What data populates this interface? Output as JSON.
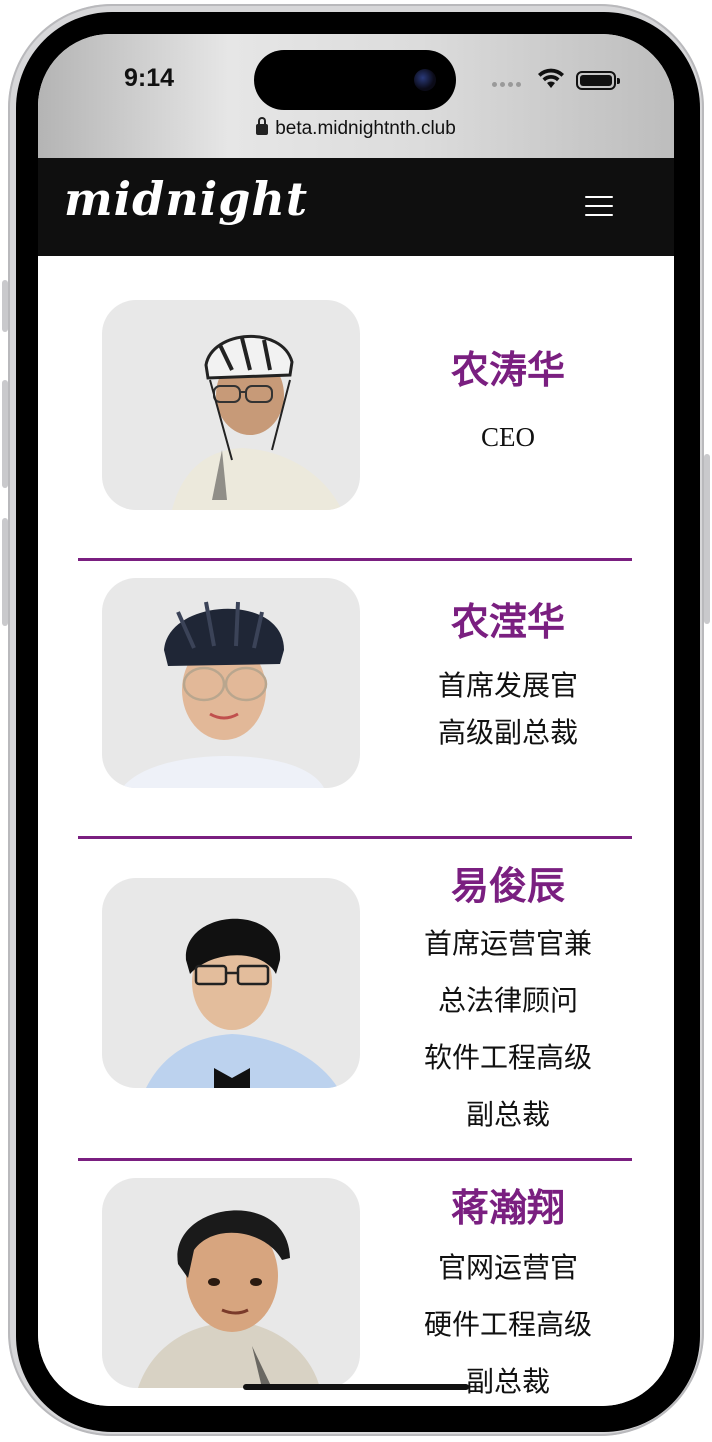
{
  "status_bar": {
    "time": "9:14"
  },
  "browser": {
    "url": "beta.midnightnth.club"
  },
  "navbar": {
    "logo": "midnight",
    "menu_icon": "hamburger-menu-icon"
  },
  "team": [
    {
      "name": "农涛华",
      "roles": [
        "CEO"
      ],
      "photo_icon": "member-photo"
    },
    {
      "name": "农滢华",
      "roles": [
        "首席发展官",
        "高级副总裁"
      ],
      "photo_icon": "member-photo"
    },
    {
      "name": "易俊辰",
      "roles": [
        "首席运营官兼",
        "总法律顾问",
        "软件工程高级",
        "副总裁"
      ],
      "photo_icon": "member-photo"
    },
    {
      "name": "蒋瀚翔",
      "roles": [
        "官网运营官",
        "硬件工程高级",
        "副总裁"
      ],
      "photo_icon": "member-photo"
    }
  ],
  "colors": {
    "accent": "#7a1f80",
    "navbar_bg": "#0f0f0f",
    "photo_bg": "#e8e8e8"
  }
}
